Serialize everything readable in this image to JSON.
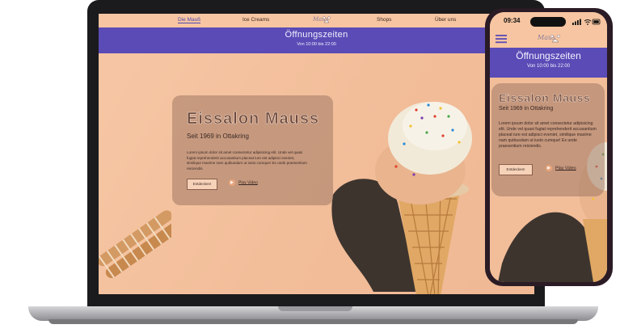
{
  "colors": {
    "peach": "#f4c3a2",
    "purple": "#5a4bb6",
    "card": "#a0786455",
    "text_dark": "#3b2a26"
  },
  "desktop": {
    "nav": {
      "items": [
        "Die Mauß",
        "Ice Creams",
        "Shops",
        "Über uns"
      ],
      "logo_text": "Maus"
    },
    "hours": {
      "title": "Öffnungszeiten",
      "subtitle": "Von 10:00 bis 22:00"
    },
    "hero": {
      "title": "Eissalon Mauss",
      "subtitle": "Seit 1969 in Ottakring",
      "body": "Lorem ipsum dolor sit amet consectetur adipisicing elit. Unde vel quasi fugiat reprehenderit accusantium placeat iure est adipisci eveniet, similique maxime nam quibusdam ut iusto cumque! Ex unde praesentium reiciendis.",
      "cta_label": "Entdecken!",
      "play_label": "Play Video"
    }
  },
  "phone": {
    "status": {
      "time": "09:34"
    },
    "logo_text": "Maus",
    "hours": {
      "title": "Öffnungszeiten",
      "subtitle": "Von 10:00 bis 22:00"
    },
    "hero": {
      "title": "Eissalon Mauss",
      "subtitle": "Seit 1969 in Ottakring",
      "body": "Lorem ipsum dolor sit amet consectetur adipisicing elit. Unde vel quasi fugiat reprehenderit accusantium placeat iure est adipisci eveniet, similique maxime nam quibusdam ut iusto cumque! Ex unde praesentium reiciendis.",
      "cta_label": "Entdecken!",
      "play_label": "Play Video"
    }
  }
}
